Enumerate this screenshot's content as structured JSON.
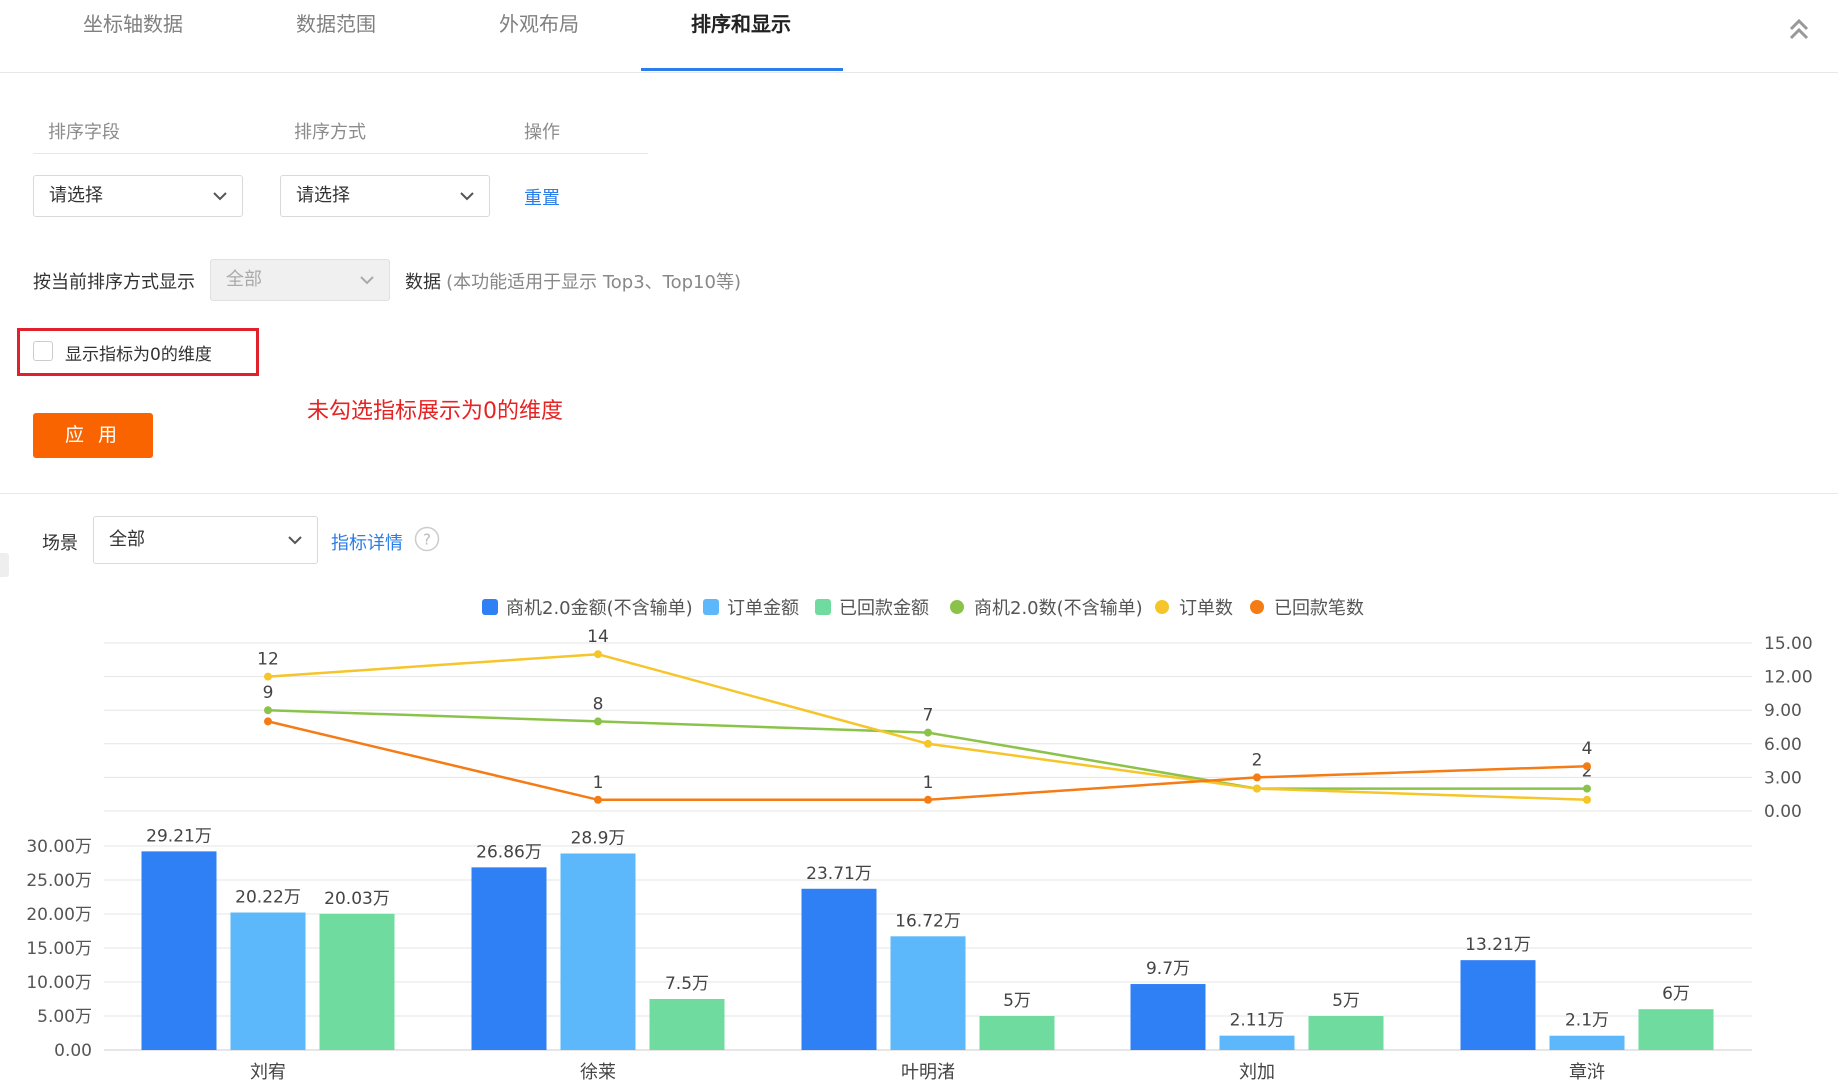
{
  "tabs": [
    {
      "label": "坐标轴数据",
      "active": false
    },
    {
      "label": "数据范围",
      "active": false
    },
    {
      "label": "外观布局",
      "active": false
    },
    {
      "label": "排序和显示",
      "active": true
    }
  ],
  "sort": {
    "headers": {
      "field": "排序字段",
      "method": "排序方式",
      "action": "操作"
    },
    "field_select": "请选择",
    "method_select": "请选择",
    "reset_label": "重置"
  },
  "display": {
    "prefix": "按当前排序方式显示",
    "select_value": "全部",
    "suffix": "数据",
    "hint": "(本功能适用于显示 Top3、Top10等)"
  },
  "zero_checkbox": {
    "label": "显示指标为0的维度",
    "checked": false
  },
  "annotation": "未勾选指标展示为0的维度",
  "apply_label": "应 用",
  "scene": {
    "label": "场景",
    "value": "全部",
    "detail_link": "指标详情",
    "help_icon": "question-circle-icon"
  },
  "colors": {
    "accent": "#2b7de9",
    "apply": "#fa6400",
    "annotation": "#e62222",
    "s1": "#2f7ff5",
    "s2": "#5cb8fa",
    "s3": "#6fdb9f",
    "l1": "#8bc34a",
    "l2": "#f5c52a",
    "l3": "#f57c14"
  },
  "chart_data": {
    "type": "bar",
    "categories": [
      "刘宥",
      "徐莱",
      "叶明渚",
      "刘加",
      "章浒"
    ],
    "series": [
      {
        "name": "商机2.0金额(不含输单)",
        "type": "bar",
        "values": [
          29.21,
          26.86,
          23.71,
          9.7,
          13.21
        ],
        "labels": [
          "29.21万",
          "26.86万",
          "23.71万",
          "9.7万",
          "13.21万"
        ],
        "color": "#2f7ff5"
      },
      {
        "name": "订单金额",
        "type": "bar",
        "values": [
          20.22,
          28.9,
          16.72,
          2.11,
          2.1
        ],
        "labels": [
          "20.22万",
          "28.9万",
          "16.72万",
          "2.11万",
          "2.1万"
        ],
        "color": "#5cb8fa"
      },
      {
        "name": "已回款金额",
        "type": "bar",
        "values": [
          20.03,
          7.5,
          5,
          5,
          6
        ],
        "labels": [
          "20.03万",
          "7.5万",
          "5万",
          "5万",
          "6万"
        ],
        "color": "#6fdb9f"
      },
      {
        "name": "商机2.0数(不含输单)",
        "type": "line",
        "values": [
          9,
          8,
          7,
          2,
          2
        ],
        "labels": [
          "9",
          "8",
          "7",
          "",
          "2"
        ],
        "color": "#8bc34a"
      },
      {
        "name": "订单数",
        "type": "line",
        "values": [
          12,
          14,
          6,
          2,
          1
        ],
        "labels": [
          "12",
          "14",
          "",
          "",
          ""
        ],
        "color": "#f5c52a"
      },
      {
        "name": "已回款笔数",
        "type": "line",
        "values": [
          8,
          1,
          1,
          3,
          4
        ],
        "labels": [
          "",
          "1",
          "1",
          "2",
          "4"
        ],
        "color": "#f57c14"
      }
    ],
    "bar_axis": {
      "ticks": [
        "0.00",
        "5.00万",
        "10.00万",
        "15.00万",
        "20.00万",
        "25.00万",
        "30.00万"
      ],
      "range": [
        0,
        30
      ]
    },
    "line_axis": {
      "ticks": [
        "0.00",
        "3.00",
        "6.00",
        "9.00",
        "12.00",
        "15.00"
      ],
      "range": [
        0,
        15
      ]
    },
    "legend_position": "top-center",
    "grid": true
  }
}
